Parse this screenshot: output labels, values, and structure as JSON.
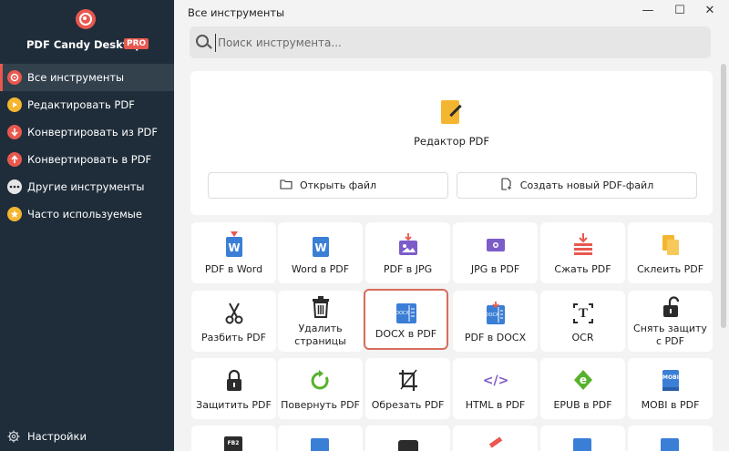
{
  "app": {
    "name": "PDF Candy Desktop",
    "badge": "PRO",
    "window_title": "Все инструменты"
  },
  "colors": {
    "sidebar_bg": "#1f2d3a",
    "accent": "#e8584f",
    "yellow": "#f4b630",
    "blue": "#3b7ed6",
    "purple": "#7b5cc9",
    "green": "#57b12d"
  },
  "sidebar": {
    "items": [
      {
        "label": "Все инструменты",
        "icon": "candy-icon",
        "active": true
      },
      {
        "label": "Редактировать PDF",
        "icon": "edit-icon",
        "active": false
      },
      {
        "label": "Конвертировать из PDF",
        "icon": "convert-from-icon",
        "active": false
      },
      {
        "label": "Конвертировать в PDF",
        "icon": "convert-to-icon",
        "active": false
      },
      {
        "label": "Другие инструменты",
        "icon": "more-icon",
        "active": false
      },
      {
        "label": "Часто используемые",
        "icon": "star-icon",
        "active": false
      }
    ],
    "settings_label": "Настройки"
  },
  "search": {
    "placeholder": "Поиск инструмента..."
  },
  "editor": {
    "label": "Редактор PDF",
    "open_file": "Открыть файл",
    "create_new": "Создать новый PDF-файл"
  },
  "tools": [
    {
      "label": "PDF в Word",
      "icon": "pdf-to-word-icon"
    },
    {
      "label": "Word в PDF",
      "icon": "word-to-pdf-icon"
    },
    {
      "label": "PDF в JPG",
      "icon": "pdf-to-jpg-icon"
    },
    {
      "label": "JPG в PDF",
      "icon": "jpg-to-pdf-icon"
    },
    {
      "label": "Сжать PDF",
      "icon": "compress-icon"
    },
    {
      "label": "Склеить PDF",
      "icon": "merge-icon"
    },
    {
      "label": "Разбить PDF",
      "icon": "scissors-icon"
    },
    {
      "label": "Удалить страницы",
      "icon": "trash-icon"
    },
    {
      "label": "DOCX в PDF",
      "icon": "docx-to-pdf-icon"
    },
    {
      "label": "PDF в DOCX",
      "icon": "pdf-to-docx-icon"
    },
    {
      "label": "OCR",
      "icon": "ocr-icon"
    },
    {
      "label": "Снять защиту с PDF",
      "icon": "unlock-icon"
    },
    {
      "label": "Защитить PDF",
      "icon": "lock-icon"
    },
    {
      "label": "Повернуть PDF",
      "icon": "rotate-icon"
    },
    {
      "label": "Обрезать PDF",
      "icon": "crop-icon"
    },
    {
      "label": "HTML в PDF",
      "icon": "html-icon"
    },
    {
      "label": "EPUB в PDF",
      "icon": "epub-icon"
    },
    {
      "label": "MOBI в PDF",
      "icon": "mobi-icon"
    }
  ],
  "icon_text": {
    "word": "W",
    "docx": "DOCX",
    "ocr": "T",
    "html": "</>",
    "epub": "e",
    "mobi": "MOBI",
    "fb2": "FB2"
  },
  "window_controls": {
    "minimize": "—",
    "maximize": "☐",
    "close": "✕"
  }
}
